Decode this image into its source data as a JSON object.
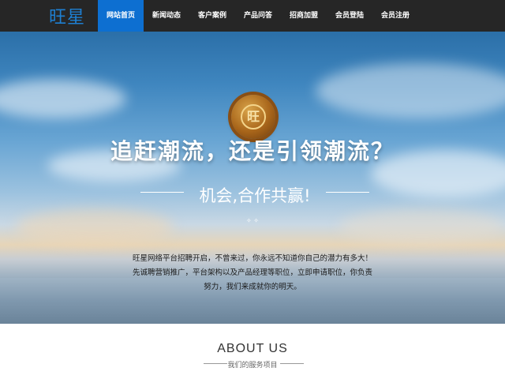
{
  "nav": {
    "logo": "旺星",
    "items": [
      {
        "label": "网站首页",
        "active": true
      },
      {
        "label": "新闻动态",
        "active": false
      },
      {
        "label": "客户案例",
        "active": false
      },
      {
        "label": "产品问答",
        "active": false
      },
      {
        "label": "招商加盟",
        "active": false
      },
      {
        "label": "会员登陆",
        "active": false
      },
      {
        "label": "会员注册",
        "active": false
      }
    ]
  },
  "hero": {
    "seal_text": "旺",
    "headline": "追赶潮流，还是引领潮流？",
    "subline": "机会,合作共赢!",
    "paragraph": [
      "旺星网络平台招聘开启，不曾来过，你永远不知道你自己的潜力有多大！",
      "先诚聘营销推广，平台架构以及产品经理等职位，立即申请职位，你负责",
      "努力，我们来成就你的明天。"
    ]
  },
  "about": {
    "title": "ABOUT US",
    "subtitle": "我们的服务项目"
  },
  "colors": {
    "navbar": "#262626",
    "active_tab": "#0d6fd1",
    "logo": "#1e7fd1"
  }
}
